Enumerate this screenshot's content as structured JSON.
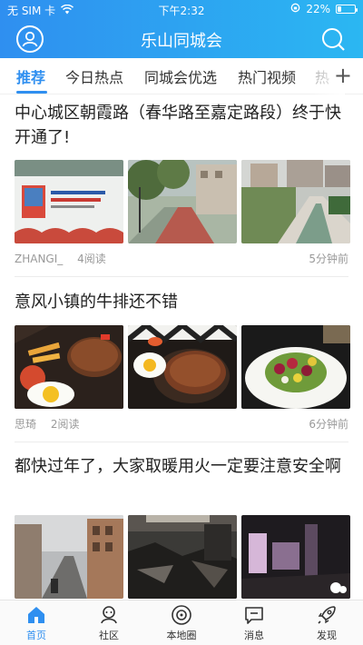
{
  "status": {
    "carrier": "无 SIM 卡",
    "wifi_icon": "wifi-icon",
    "time": "下午2:32",
    "lock_icon": "rotation-lock-icon",
    "battery_text": "22%",
    "battery_level": 0.22
  },
  "header": {
    "title": "乐山同城会",
    "avatar_icon": "user-avatar-icon",
    "search_icon": "search-icon",
    "gradient_start": "#2f8ff0",
    "gradient_end": "#2bb7f2"
  },
  "tabs": {
    "items": [
      "推荐",
      "今日热点",
      "同城会优选",
      "热门视频",
      "热"
    ],
    "active_index": 0,
    "more_label": "+",
    "accent": "#2f8ff0"
  },
  "posts": [
    {
      "title": "中心城区朝霞路（春华路至嘉定路段）终于快开通了!",
      "author": "ZHANGI_",
      "reads": "4阅读",
      "ago": "5分钟前",
      "images": [
        "construction-hoarding-photo",
        "tree-lined-road-photo",
        "river-road-photo"
      ]
    },
    {
      "title": "意风小镇的牛排还不错",
      "author": "思琦",
      "reads": "2阅读",
      "ago": "6分钟前",
      "images": [
        "steak-plate-photo",
        "sizzling-steak-photo",
        "salad-plate-photo"
      ]
    },
    {
      "title": "都快过年了，大家取暖用火一定要注意安全啊",
      "author": "",
      "reads": "",
      "ago": "",
      "images": [
        "street-scene-photo",
        "burnt-debris-photo",
        "burnt-room-photo"
      ]
    }
  ],
  "bottom_nav": [
    {
      "label": "首页",
      "icon": "home-icon",
      "active": true
    },
    {
      "label": "社区",
      "icon": "community-icon",
      "active": false
    },
    {
      "label": "本地圈",
      "icon": "local-circle-icon",
      "active": false
    },
    {
      "label": "消息",
      "icon": "message-icon",
      "active": false
    },
    {
      "label": "发现",
      "icon": "rocket-icon",
      "active": false
    }
  ]
}
